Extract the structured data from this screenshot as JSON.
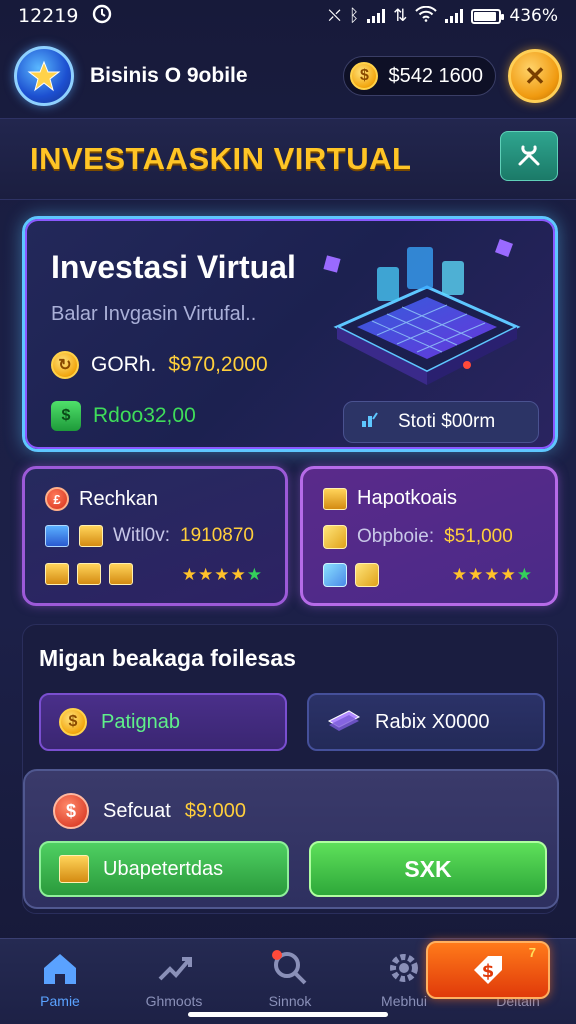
{
  "status_bar": {
    "time": "12219",
    "battery_text": "436%"
  },
  "header": {
    "brand": "Bisinis O 9obile",
    "balance": "$542 1600"
  },
  "section": {
    "title": "INVESTAASKIN VIRTUAL"
  },
  "hero": {
    "title": "Investasi Virtual",
    "subtitle": "Balar Invgasin Virtufal..",
    "row1_label": "GORh.",
    "row1_value": "$970,2000",
    "row2_value": "Rdoo32,00",
    "stat_label": "Stoti $00rm"
  },
  "cards": [
    {
      "title": "Rechkan",
      "line_label": "Witl0v:",
      "line_value": "1910870",
      "stars": 5
    },
    {
      "title": "Hapotkoais",
      "line_label": "Obpboie:",
      "line_value": "$51,000",
      "stars": 5
    }
  ],
  "panel": {
    "title": "Migan beakaga foilesas",
    "option_a": "Patignab",
    "option_b": "Rabix X0000",
    "sub_label": "Sefcuat",
    "sub_value": "$9:000",
    "action_left": "Ubapetertdas",
    "action_right": "SXK"
  },
  "nav": {
    "items": [
      "Pamie",
      "Ghmoots",
      "Sinnok",
      "Mebhui",
      "Deltain"
    ],
    "fab_badge": "7"
  },
  "colors": {
    "accent_gold": "#ffc526",
    "accent_green": "#3fdc5a",
    "accent_blue": "#5ec7ff",
    "accent_purple": "#9c5ad8"
  }
}
